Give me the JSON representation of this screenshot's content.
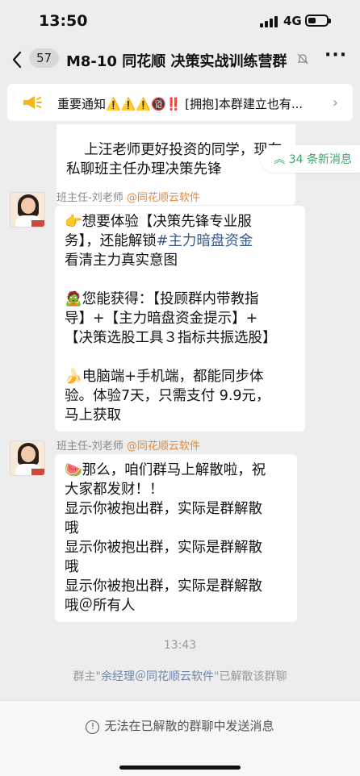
{
  "status": {
    "time": "13:50",
    "network": "4G",
    "battery_level": 0.45
  },
  "nav": {
    "unread_count": "57",
    "title": "M8-10 同花顺 决策实战训练营群"
  },
  "notice": {
    "text": "重要通知⚠️⚠️⚠️🔞‼️ [拥抱]本群建立也有..."
  },
  "new_messages": "34 条新消息",
  "messages": [
    {
      "text": "上汪老师更好投资的同学，现在\n私聊班主任办理决策先锋"
    },
    {
      "sender": "班主任-刘老师",
      "org": "@同花顺云软件",
      "lines": [
        {
          "pre": "👉想要体验【决策先锋专业服\n务】，还能解锁",
          "hl": "#主力暗盘资金",
          "post": "\n看清主力真实意图"
        },
        {
          "pre": "\n\n🧟您能获得：【投顾群内带教指\n导】+【主力暗盘资金提示】+\n【决策选股工具３指标共振选股】\n\n🍌电脑端+手机端，都能同步体\n验。体验7天，只需支付 9.9元，\n马上获取"
        }
      ]
    },
    {
      "sender": "班主任-刘老师",
      "org": "@同花顺云软件",
      "text": "🍉那么，咱们群马上解散啦，祝\n大家都发财！！\n显示你被抱出群，实际是群解散\n哦\n显示你被抱出群，实际是群解散\n哦\n显示你被抱出群，实际是群解散\n哦＠所有人"
    }
  ],
  "timestamp": "13:43",
  "system": {
    "prefix": "群主\"",
    "link": "余经理＠同花顺云软件",
    "suffix": "\"已解散该群聊"
  },
  "footer": {
    "note": "无法在已解散的群聊中发送消息"
  }
}
